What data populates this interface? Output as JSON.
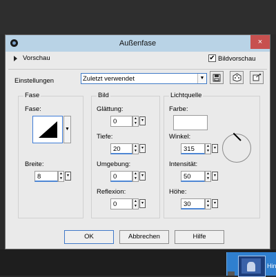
{
  "dialog": {
    "title": "Außenfase",
    "close_label": "×"
  },
  "preview": {
    "label": "Vorschau",
    "bildvorschau_label": "Bildvorschau",
    "bildvorschau_checked": "✔"
  },
  "settings": {
    "label": "Einstellungen",
    "value": "Zuletzt verwendet"
  },
  "fase": {
    "group_title": "Fase",
    "fase_label": "Fase:",
    "breite_label": "Breite:",
    "breite_value": "8"
  },
  "bild": {
    "group_title": "Bild",
    "glaettung_label": "Glättung:",
    "glaettung_value": "0",
    "tiefe_label": "Tiefe:",
    "tiefe_value": "20",
    "umgebung_label": "Umgebung:",
    "umgebung_value": "0",
    "reflexion_label": "Reflexion:",
    "reflexion_value": "0"
  },
  "light": {
    "group_title": "Lichtquelle",
    "farbe_label": "Farbe:",
    "winkel_label": "Winkel:",
    "winkel_value": "315",
    "intensitaet_label": "Intensität:",
    "intensitaet_value": "50",
    "hoehe_label": "Höhe:",
    "hoehe_value": "30"
  },
  "buttons": {
    "ok": "OK",
    "cancel": "Abbrechen",
    "help": "Hilfe"
  },
  "background": {
    "thumb_text": "Hin"
  },
  "colors": {
    "titlebar": "#b9d3e6",
    "close": "#c7504f",
    "focus_blue": "#3c7ad6"
  }
}
